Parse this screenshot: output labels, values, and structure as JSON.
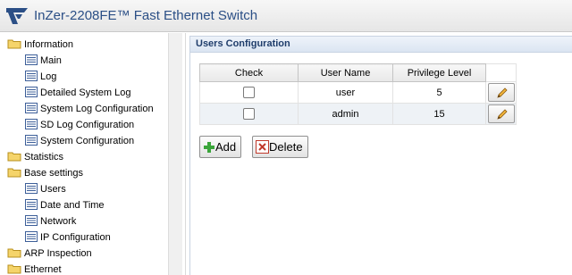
{
  "header": {
    "title": "InZer-2208FE™ Fast Ethernet Switch"
  },
  "sidebar": {
    "items": [
      {
        "label": "Information",
        "kind": "folder"
      },
      {
        "label": "Main",
        "kind": "page"
      },
      {
        "label": "Log",
        "kind": "page"
      },
      {
        "label": "Detailed System Log",
        "kind": "page"
      },
      {
        "label": "System Log Configuration",
        "kind": "page"
      },
      {
        "label": "SD Log Configuration",
        "kind": "page"
      },
      {
        "label": "System Configuration",
        "kind": "page"
      },
      {
        "label": "Statistics",
        "kind": "folder"
      },
      {
        "label": "Base settings",
        "kind": "folder"
      },
      {
        "label": "Users",
        "kind": "page"
      },
      {
        "label": "Date and Time",
        "kind": "page"
      },
      {
        "label": "Network",
        "kind": "page"
      },
      {
        "label": "IP Configuration",
        "kind": "page"
      },
      {
        "label": "ARP Inspection",
        "kind": "folder"
      },
      {
        "label": "Ethernet",
        "kind": "folder"
      }
    ]
  },
  "main": {
    "panel_title": "Users Configuration",
    "table": {
      "headers": [
        "Check",
        "User Name",
        "Privilege Level"
      ],
      "rows": [
        {
          "user": "user",
          "level": "5"
        },
        {
          "user": "admin",
          "level": "15"
        }
      ]
    },
    "buttons": {
      "add": "Add",
      "delete": "Delete"
    }
  },
  "colors": {
    "title": "#2b4f86",
    "panel_title": "#1f3d6b",
    "folder": "#f2c94c",
    "edit_icon": "#e0a82e"
  }
}
